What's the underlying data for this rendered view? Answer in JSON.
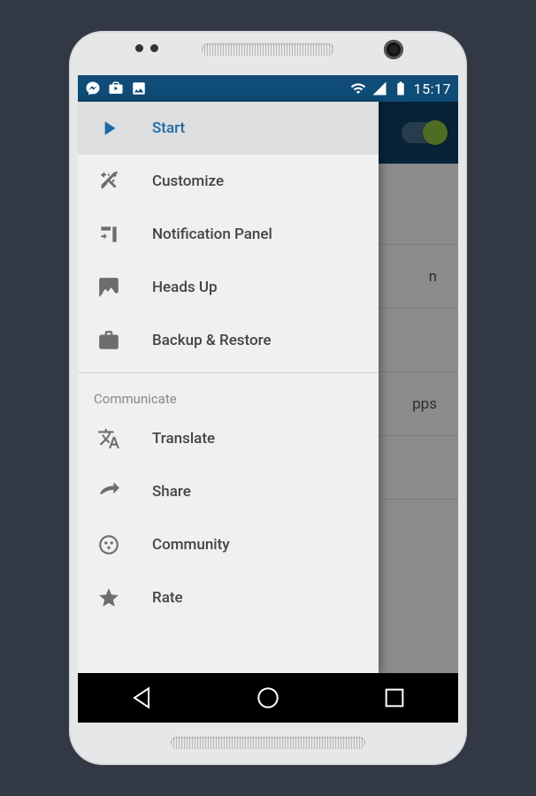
{
  "statusbar": {
    "time": "15:17"
  },
  "background": {
    "items": [
      "",
      "n",
      "",
      "pps",
      ""
    ]
  },
  "drawer": {
    "main": [
      {
        "label": "Start",
        "icon": "play",
        "active": true
      },
      {
        "label": "Customize",
        "icon": "wand",
        "active": false
      },
      {
        "label": "Notification Panel",
        "icon": "panel",
        "active": false
      },
      {
        "label": "Heads Up",
        "icon": "message",
        "active": false
      },
      {
        "label": "Backup & Restore",
        "icon": "briefcase",
        "active": false
      }
    ],
    "section_label": "Communicate",
    "communicate": [
      {
        "label": "Translate",
        "icon": "translate"
      },
      {
        "label": "Share",
        "icon": "share"
      },
      {
        "label": "Community",
        "icon": "community"
      },
      {
        "label": "Rate",
        "icon": "star"
      }
    ]
  }
}
